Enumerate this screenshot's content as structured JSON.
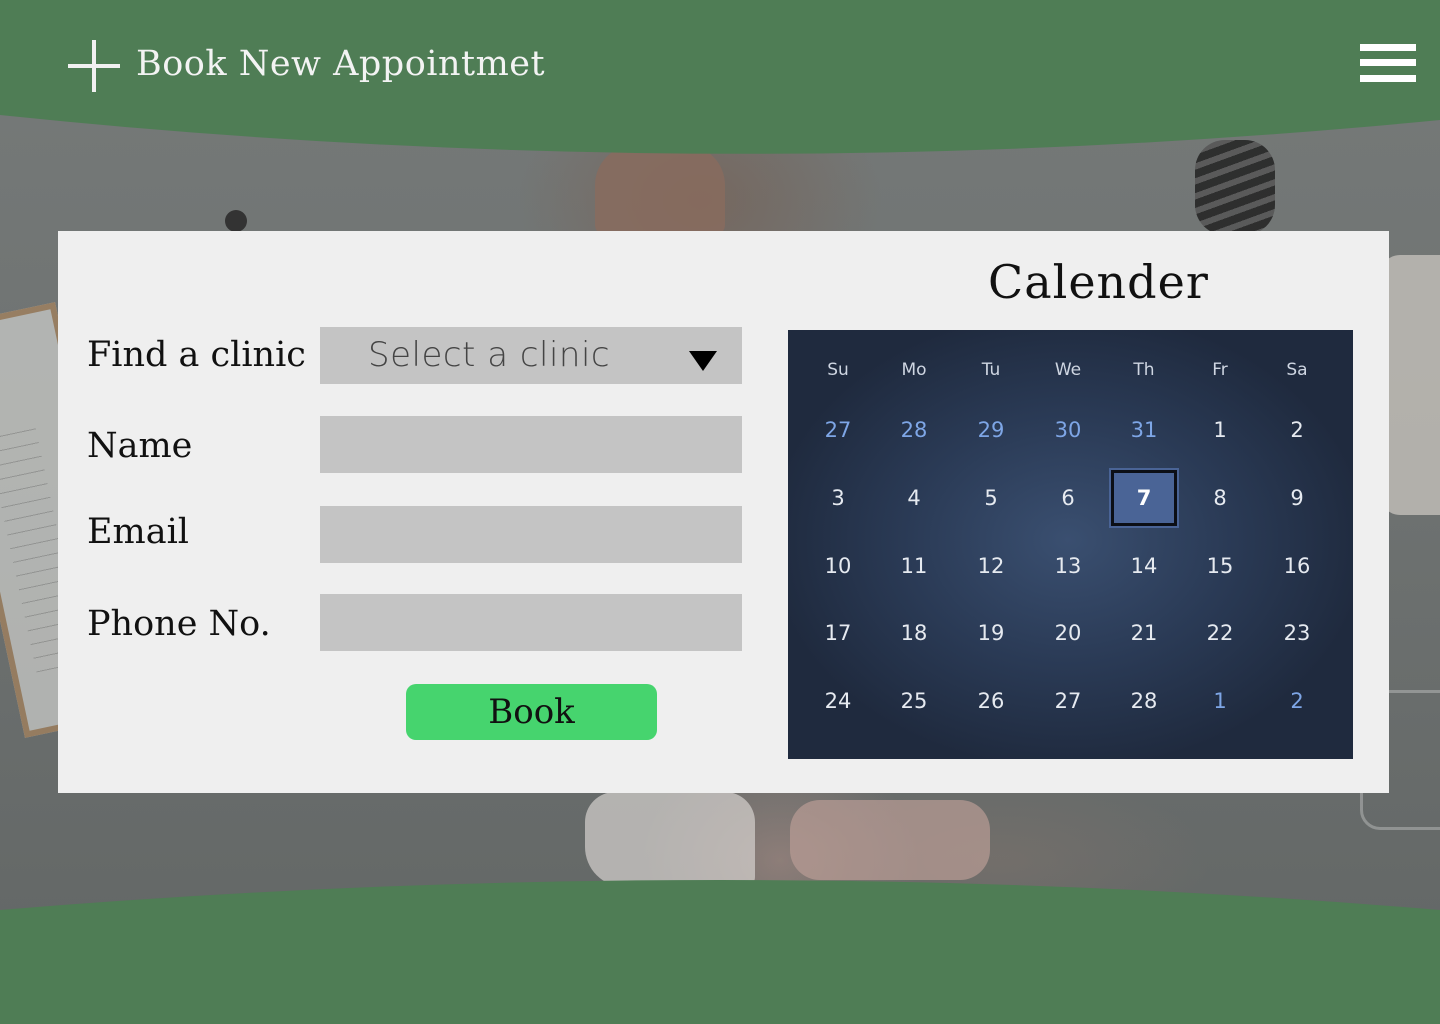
{
  "header": {
    "title": "Book New Appointmet",
    "add_icon": "plus-icon",
    "menu_icon": "hamburger-menu-icon"
  },
  "colors": {
    "band_green": "#4f7d55",
    "card_bg": "#efefef",
    "field_bg": "#c4c4c4",
    "book_button": "#46d46e",
    "calendar_bg": "#2a3a55",
    "calendar_selected": "#4a6496",
    "calendar_other_month": "#7ea6e6"
  },
  "form": {
    "clinic_label": "Find a clinic",
    "clinic_placeholder": "Select a clinic",
    "name_label": "Name",
    "email_label": "Email",
    "phone_label": "Phone No.",
    "name_value": "",
    "email_value": "",
    "phone_value": "",
    "book_label": "Book"
  },
  "calendar": {
    "title": "Calender",
    "weekdays": [
      "Su",
      "Mo",
      "Tu",
      "We",
      "Th",
      "Fr",
      "Sa"
    ],
    "selected_day": "7",
    "weeks": [
      [
        {
          "d": "27",
          "other": true
        },
        {
          "d": "28",
          "other": true
        },
        {
          "d": "29",
          "other": true
        },
        {
          "d": "30",
          "other": true
        },
        {
          "d": "31",
          "other": true
        },
        {
          "d": "1",
          "other": false
        },
        {
          "d": "2",
          "other": false
        }
      ],
      [
        {
          "d": "3",
          "other": false
        },
        {
          "d": "4",
          "other": false
        },
        {
          "d": "5",
          "other": false
        },
        {
          "d": "6",
          "other": false
        },
        {
          "d": "7",
          "other": false
        },
        {
          "d": "8",
          "other": false
        },
        {
          "d": "9",
          "other": false
        }
      ],
      [
        {
          "d": "10",
          "other": false
        },
        {
          "d": "11",
          "other": false
        },
        {
          "d": "12",
          "other": false
        },
        {
          "d": "13",
          "other": false
        },
        {
          "d": "14",
          "other": false
        },
        {
          "d": "15",
          "other": false
        },
        {
          "d": "16",
          "other": false
        }
      ],
      [
        {
          "d": "17",
          "other": false
        },
        {
          "d": "18",
          "other": false
        },
        {
          "d": "19",
          "other": false
        },
        {
          "d": "20",
          "other": false
        },
        {
          "d": "21",
          "other": false
        },
        {
          "d": "22",
          "other": false
        },
        {
          "d": "23",
          "other": false
        }
      ],
      [
        {
          "d": "24",
          "other": false
        },
        {
          "d": "25",
          "other": false
        },
        {
          "d": "26",
          "other": false
        },
        {
          "d": "27",
          "other": false
        },
        {
          "d": "28",
          "other": false
        },
        {
          "d": "1",
          "other": true
        },
        {
          "d": "2",
          "other": true
        }
      ]
    ]
  }
}
